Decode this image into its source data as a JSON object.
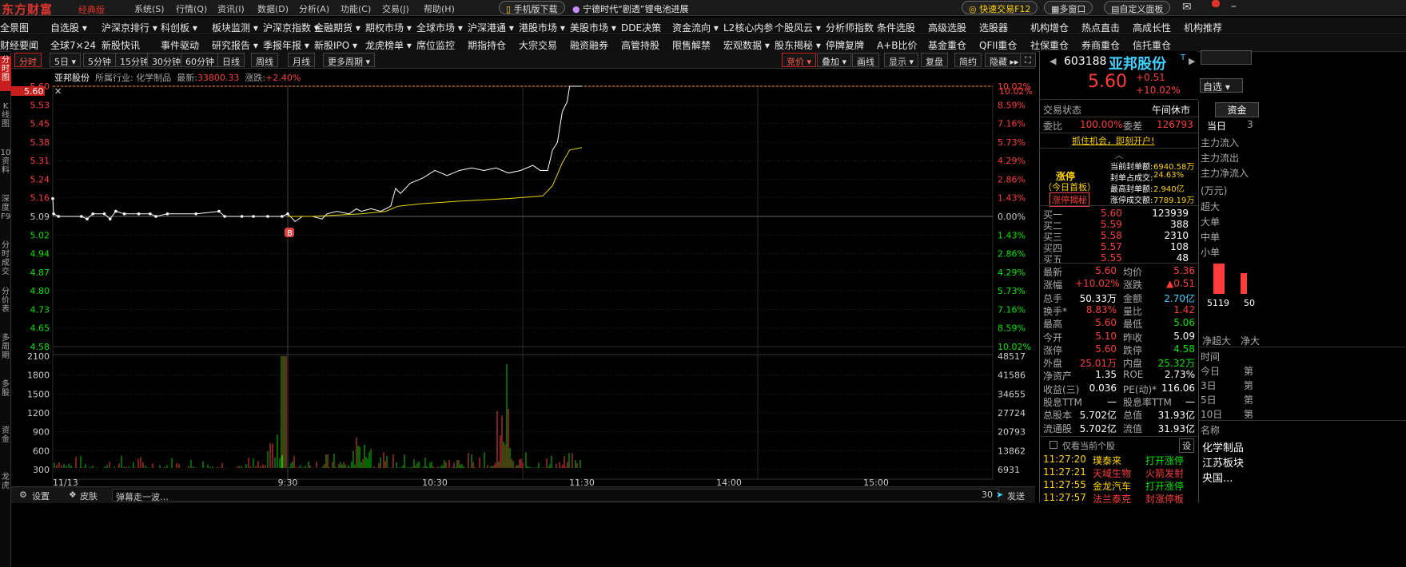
{
  "titlebar": {
    "logo": "东方财富",
    "edition": "经典版",
    "menus": [
      "系统(S)",
      "行情(Q)",
      "资讯(I)",
      "数据(D)",
      "分析(A)",
      "功能(C)",
      "交易(J)",
      "帮助(H)"
    ],
    "mobile": "手机版下载",
    "news": "宁德时代“剧透”锂电池进展",
    "quick_trade": "快速交易F12",
    "multi_window": "多窗口",
    "custom_panel": "自定义面板"
  },
  "nav1": [
    "全景图",
    "自选股 ▾",
    "沪深京排行 ▾",
    "科创板 ▾",
    "板块监测 ▾",
    "沪深京指数 ▾",
    "金融期货 ▾",
    "期权市场 ▾",
    "全球市场 ▾",
    "沪深港通 ▾",
    "港股市场 ▾",
    "美股市场 ▾",
    "DDE决策",
    "资金流向 ▾",
    "L2核心内参",
    "个股风云 ▾",
    "分析师指数",
    "条件选股",
    "高级选股",
    "选股器",
    "机构增仓",
    "热点直击",
    "高成长性",
    "机构推荐"
  ],
  "nav2": [
    "财经要闻",
    "全球7×24",
    "新股快讯",
    "事件驱动",
    "研究报告 ▾",
    "季报年报 ▾",
    "新股IPO ▾",
    "龙虎榜单 ▾",
    "席位监控",
    "期指持仓",
    "大宗交易",
    "融资融券",
    "高管持股",
    "限售解禁",
    "宏观数据 ▾",
    "股东揭秘 ▾",
    "停牌复牌",
    "A+B比价",
    "基金重仓",
    "QFII重仓",
    "社保重仓",
    "券商重仓",
    "信托重仓"
  ],
  "lefttabs": [
    "分时图",
    "K线图",
    "10资料",
    "深度F9",
    "分时成交",
    "分价表",
    "多周期",
    "多股",
    "资金",
    "龙虎"
  ],
  "periodbar": {
    "left": [
      "分时",
      "5日 ▾",
      "5分钟",
      "15分钟",
      "30分钟",
      "60分钟",
      "日线",
      "周线",
      "月线",
      "更多周期 ▾"
    ],
    "right": [
      "竞价 ▾",
      "叠加 ▾",
      "画线",
      "显示 ▾",
      "复盘",
      "简约",
      "隐藏 ▸▸"
    ]
  },
  "chart_head": {
    "name": "亚邦股份",
    "industry": "所属行业: 化学制品",
    "latest_label": "最新:",
    "latest": "33800.33",
    "change_label": "涨跌:",
    "change": "+2.40%"
  },
  "chart_data": {
    "type": "line",
    "xlabels": [
      "11/13",
      "9:30",
      "10:30",
      "11:30",
      "14:00",
      "15:00"
    ],
    "price_ticks": [
      "5.60",
      "5.53",
      "5.45",
      "5.38",
      "5.31",
      "5.24",
      "5.16",
      "5.09",
      "5.02",
      "4.94",
      "4.87",
      "4.80",
      "4.73",
      "4.65",
      "4.58"
    ],
    "pct_ticks": [
      "10.02%",
      "8.59%",
      "7.16%",
      "5.73%",
      "4.29%",
      "2.86%",
      "1.43%",
      "0.00%",
      "1.43%",
      "2.86%",
      "4.29%",
      "5.73%",
      "7.16%",
      "8.59%",
      "10.02%"
    ],
    "vol_ticks_left": [
      "2100",
      "1800",
      "1500",
      "1200",
      "900",
      "600",
      "300"
    ],
    "vol_ticks_right": [
      "48517",
      "41586",
      "34655",
      "27724",
      "20793",
      "13862",
      "6931"
    ],
    "ylim": [
      4.58,
      5.6
    ],
    "prev_close": 5.09,
    "cursor_price": "5.60",
    "cursor_pct": "10.02%",
    "prev_day_price": [
      [
        0,
        5.16
      ],
      [
        0.3,
        5.1
      ],
      [
        2,
        5.09
      ],
      [
        10,
        5.09
      ],
      [
        12,
        5.08
      ],
      [
        14,
        5.1
      ],
      [
        18,
        5.1
      ],
      [
        20,
        5.08
      ],
      [
        22,
        5.11
      ],
      [
        25,
        5.1
      ],
      [
        30,
        5.1
      ],
      [
        34,
        5.1
      ],
      [
        36,
        5.09
      ],
      [
        40,
        5.1
      ],
      [
        50,
        5.1
      ],
      [
        58,
        5.11
      ],
      [
        60,
        5.09
      ],
      [
        66,
        5.09
      ],
      [
        70,
        5.09
      ],
      [
        75,
        5.09
      ],
      [
        80,
        5.09
      ],
      [
        82,
        5.1
      ]
    ],
    "price": [
      [
        0,
        5.1
      ],
      [
        3,
        5.07
      ],
      [
        6,
        5.09
      ],
      [
        10,
        5.09
      ],
      [
        14,
        5.08
      ],
      [
        16,
        5.1
      ],
      [
        20,
        5.11
      ],
      [
        25,
        5.1
      ],
      [
        28,
        5.12
      ],
      [
        30,
        5.11
      ],
      [
        34,
        5.12
      ],
      [
        38,
        5.11
      ],
      [
        42,
        5.13
      ],
      [
        44,
        5.2
      ],
      [
        46,
        5.18
      ],
      [
        50,
        5.22
      ],
      [
        55,
        5.24
      ],
      [
        60,
        5.27
      ],
      [
        65,
        5.25
      ],
      [
        70,
        5.27
      ],
      [
        75,
        5.28
      ],
      [
        80,
        5.27
      ],
      [
        85,
        5.28
      ],
      [
        90,
        5.26
      ],
      [
        95,
        5.27
      ],
      [
        100,
        5.29
      ],
      [
        103,
        5.27
      ],
      [
        106,
        5.27
      ],
      [
        108,
        5.35
      ],
      [
        110,
        5.38
      ],
      [
        112,
        5.5
      ],
      [
        114,
        5.54
      ],
      [
        115,
        5.6
      ],
      [
        120,
        5.6
      ],
      [
        150,
        5.6
      ]
    ],
    "avg": [
      [
        0,
        5.09
      ],
      [
        10,
        5.09
      ],
      [
        30,
        5.1
      ],
      [
        40,
        5.11
      ],
      [
        45,
        5.13
      ],
      [
        55,
        5.14
      ],
      [
        70,
        5.15
      ],
      [
        90,
        5.16
      ],
      [
        104,
        5.17
      ],
      [
        108,
        5.21
      ],
      [
        112,
        5.3
      ],
      [
        115,
        5.35
      ],
      [
        120,
        5.36
      ],
      [
        150,
        5.36
      ]
    ],
    "volume_note": "minute volume bars, red = up, green = down"
  },
  "statusbar": {
    "settings": "设置",
    "skin": "皮肤",
    "danmu_placeholder": "弹幕走一波…",
    "count": "30",
    "send": "发送"
  },
  "quote": {
    "code": "603188",
    "name": "亚邦股份",
    "price": "5.60",
    "change": "+0.51",
    "pct": "+10.02%",
    "watch_btn": "自选 ▾",
    "status_label": "交易状态",
    "status": "午间休市",
    "ratio_label": "委比",
    "ratio": "100.00%",
    "diff_label": "委差",
    "diff": "126793",
    "open_account": "抓住机会，即刻开户!",
    "limit_title": "涨停",
    "limit_sub": "（今日首板）",
    "limit_reveal": "涨停揭秘",
    "limit_stats": [
      [
        "当前封单额:",
        "6940.58万"
      ],
      [
        "封单占成交:",
        "24.63%"
      ],
      [
        "最高封单额:",
        "2.940亿"
      ],
      [
        "涨停成交额:",
        "7789.19万"
      ]
    ],
    "bids": [
      [
        "买一",
        "5.60",
        "123939"
      ],
      [
        "买二",
        "5.59",
        "388"
      ],
      [
        "买三",
        "5.58",
        "2310"
      ],
      [
        "买四",
        "5.57",
        "108"
      ],
      [
        "买五",
        "5.55",
        "48"
      ]
    ],
    "stats": [
      [
        "最新",
        "5.60",
        "均价",
        "5.36"
      ],
      [
        "涨幅",
        "+10.02%",
        "涨跌",
        "▲0.51"
      ],
      [
        "总手",
        "50.33万",
        "金额",
        "2.70亿"
      ],
      [
        "换手*",
        "8.83%",
        "量比",
        "1.42"
      ],
      [
        "最高",
        "5.60",
        "最低",
        "5.06"
      ],
      [
        "今开",
        "5.10",
        "昨收",
        "5.09"
      ],
      [
        "涨停",
        "5.60",
        "跌停",
        "4.58"
      ],
      [
        "外盘",
        "25.01万",
        "内盘",
        "25.32万"
      ],
      [
        "净资产",
        "1.35",
        "ROE",
        "2.73%"
      ],
      [
        "收益(三)",
        "0.036",
        "PE(动)*",
        "116.06"
      ],
      [
        "股息TTM",
        "一",
        "股息率TTM",
        "一"
      ],
      [
        "总股本",
        "5.702亿",
        "总值",
        "31.93亿"
      ],
      [
        "流通股",
        "5.702亿",
        "流值",
        "31.93亿"
      ]
    ],
    "only_current": "仅看当前个股",
    "settings_btn": "设",
    "alerts": [
      [
        "11:27:20",
        "璞泰来",
        "打开涨停"
      ],
      [
        "11:27:21",
        "天域生物",
        "火箭发射"
      ],
      [
        "11:27:55",
        "金龙汽车",
        "打开涨停"
      ],
      [
        "11:27:57",
        "法兰泰克",
        "封涨停板"
      ]
    ]
  },
  "far": {
    "tab1": "资金",
    "tab2a": "当日",
    "tab2b": "3",
    "flows": [
      "主力流入",
      "主力流出",
      "主力净流入"
    ],
    "unit": "(万元)",
    "sizes": [
      "超大",
      "大单",
      "中单",
      "小单"
    ],
    "bar_label1": "5119",
    "bar_label2": "50",
    "net_labels": [
      "净超大",
      "净大"
    ],
    "time_rows": [
      "时间",
      "今日",
      "3日",
      "5日",
      "10日"
    ],
    "time_right": [
      "第",
      "第",
      "第",
      "第"
    ],
    "name_label": "名称",
    "sectors": [
      "化学制品",
      "江苏板块",
      "央国..."
    ]
  }
}
